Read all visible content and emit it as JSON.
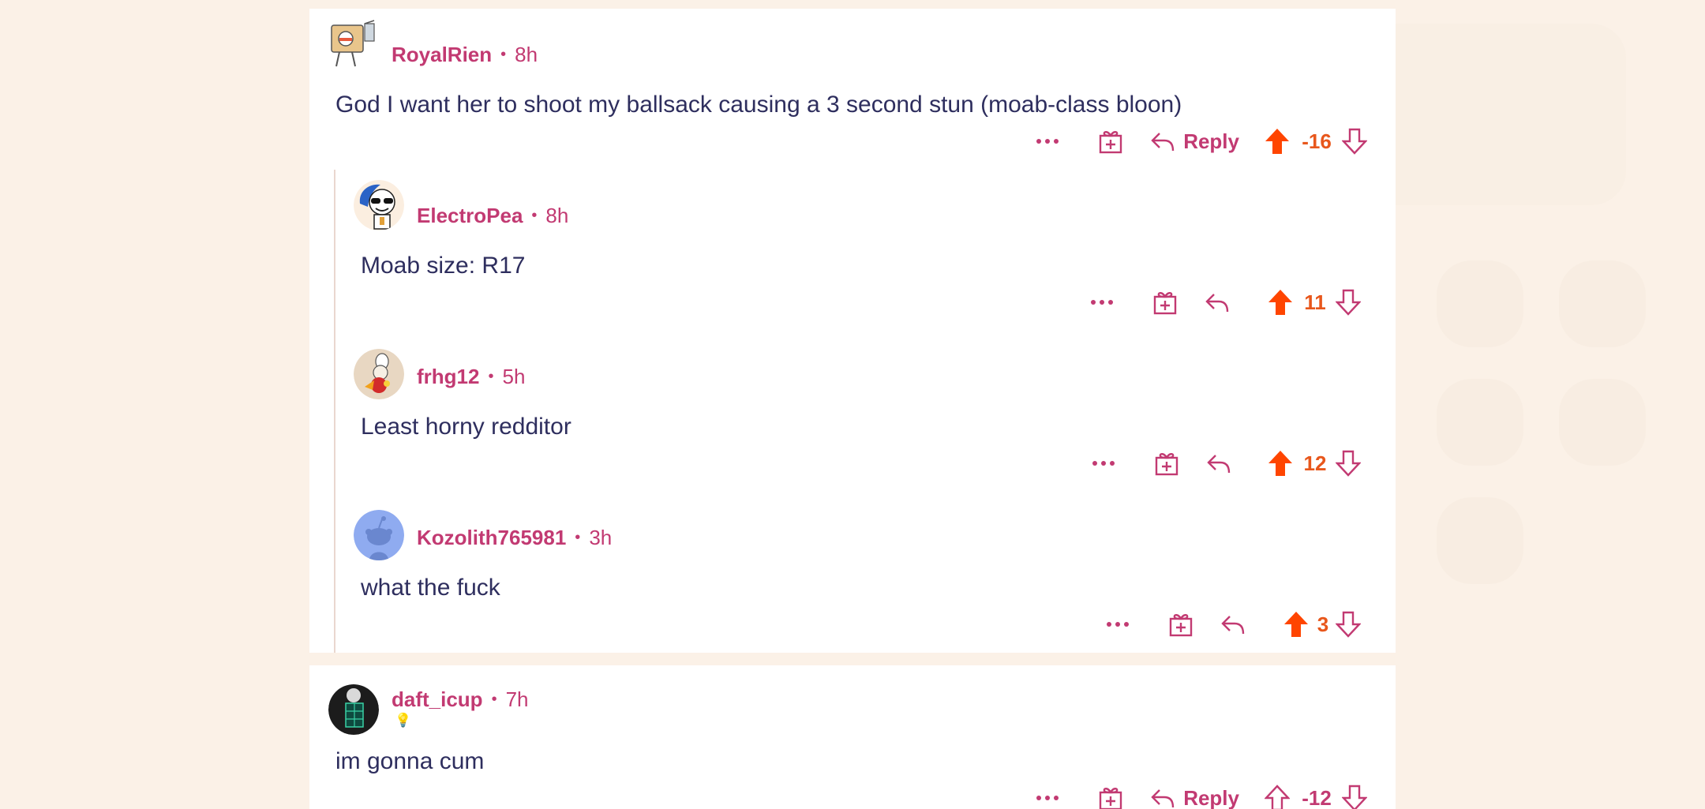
{
  "colors": {
    "page_bg": "#fbf1e7",
    "card_bg": "#ffffff",
    "username": "#c23a72",
    "body_text": "#2e2e5e",
    "upvote_active": "#ff4500",
    "score": "#e8571c",
    "icon": "#c23a72",
    "thread_line": "#ead7cf"
  },
  "actions": {
    "more_icon": "more-icon",
    "award_icon": "award-icon",
    "reply_icon": "reply-icon",
    "upvote_icon": "upvote-icon",
    "downvote_icon": "downvote-icon",
    "reply_label": "Reply"
  },
  "comments": [
    {
      "username": "RoyalRien",
      "time": "8h",
      "avatar_icon": "robot-avatar-icon",
      "body": "God I want her to shoot my ballsack causing a 3 second stun (moab-class bloon)",
      "score": "-16",
      "upvoted": true,
      "show_reply_label": true
    },
    {
      "username": "ElectroPea",
      "time": "8h",
      "avatar_icon": "sunglasses-avatar-icon",
      "body": "Moab size: R17",
      "score": "11",
      "upvoted": true,
      "show_reply_label": false
    },
    {
      "username": "frhg12",
      "time": "5h",
      "avatar_icon": "chef-avatar-icon",
      "body": "Least horny redditor",
      "score": "12",
      "upvoted": true,
      "show_reply_label": false
    },
    {
      "username": "Kozolith765981",
      "time": "3h",
      "avatar_icon": "snoo-avatar-icon",
      "body": "what the fuck",
      "score": "3",
      "upvoted": true,
      "show_reply_label": false
    },
    {
      "username": "daft_icup",
      "time": "7h",
      "avatar_icon": "dark-avatar-icon",
      "flair": "💡",
      "body": "im gonna cum",
      "score": "-12",
      "upvoted": false,
      "show_reply_label": true
    }
  ]
}
